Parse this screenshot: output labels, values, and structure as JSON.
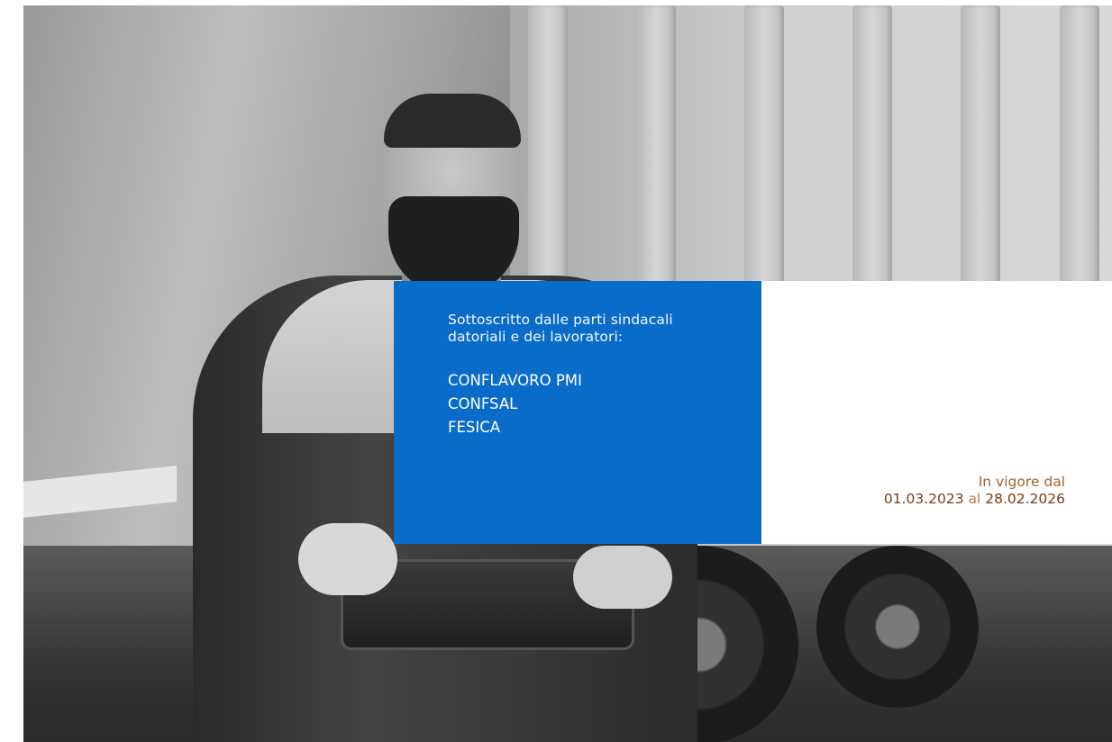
{
  "intro_text": "Sottoscritto dalle parti sindacali datoriali e dei lavoratori:",
  "organizations": [
    "CONFLAVORO PMI",
    "CONFSAL",
    "FESICA"
  ],
  "validity": {
    "label": "In vigore dal",
    "start_date": "01.03.2023",
    "connector": "al",
    "end_date": "28.02.2026"
  },
  "colors": {
    "accent_blue": "#0a6cc9",
    "date_brown": "#7a3d12"
  }
}
